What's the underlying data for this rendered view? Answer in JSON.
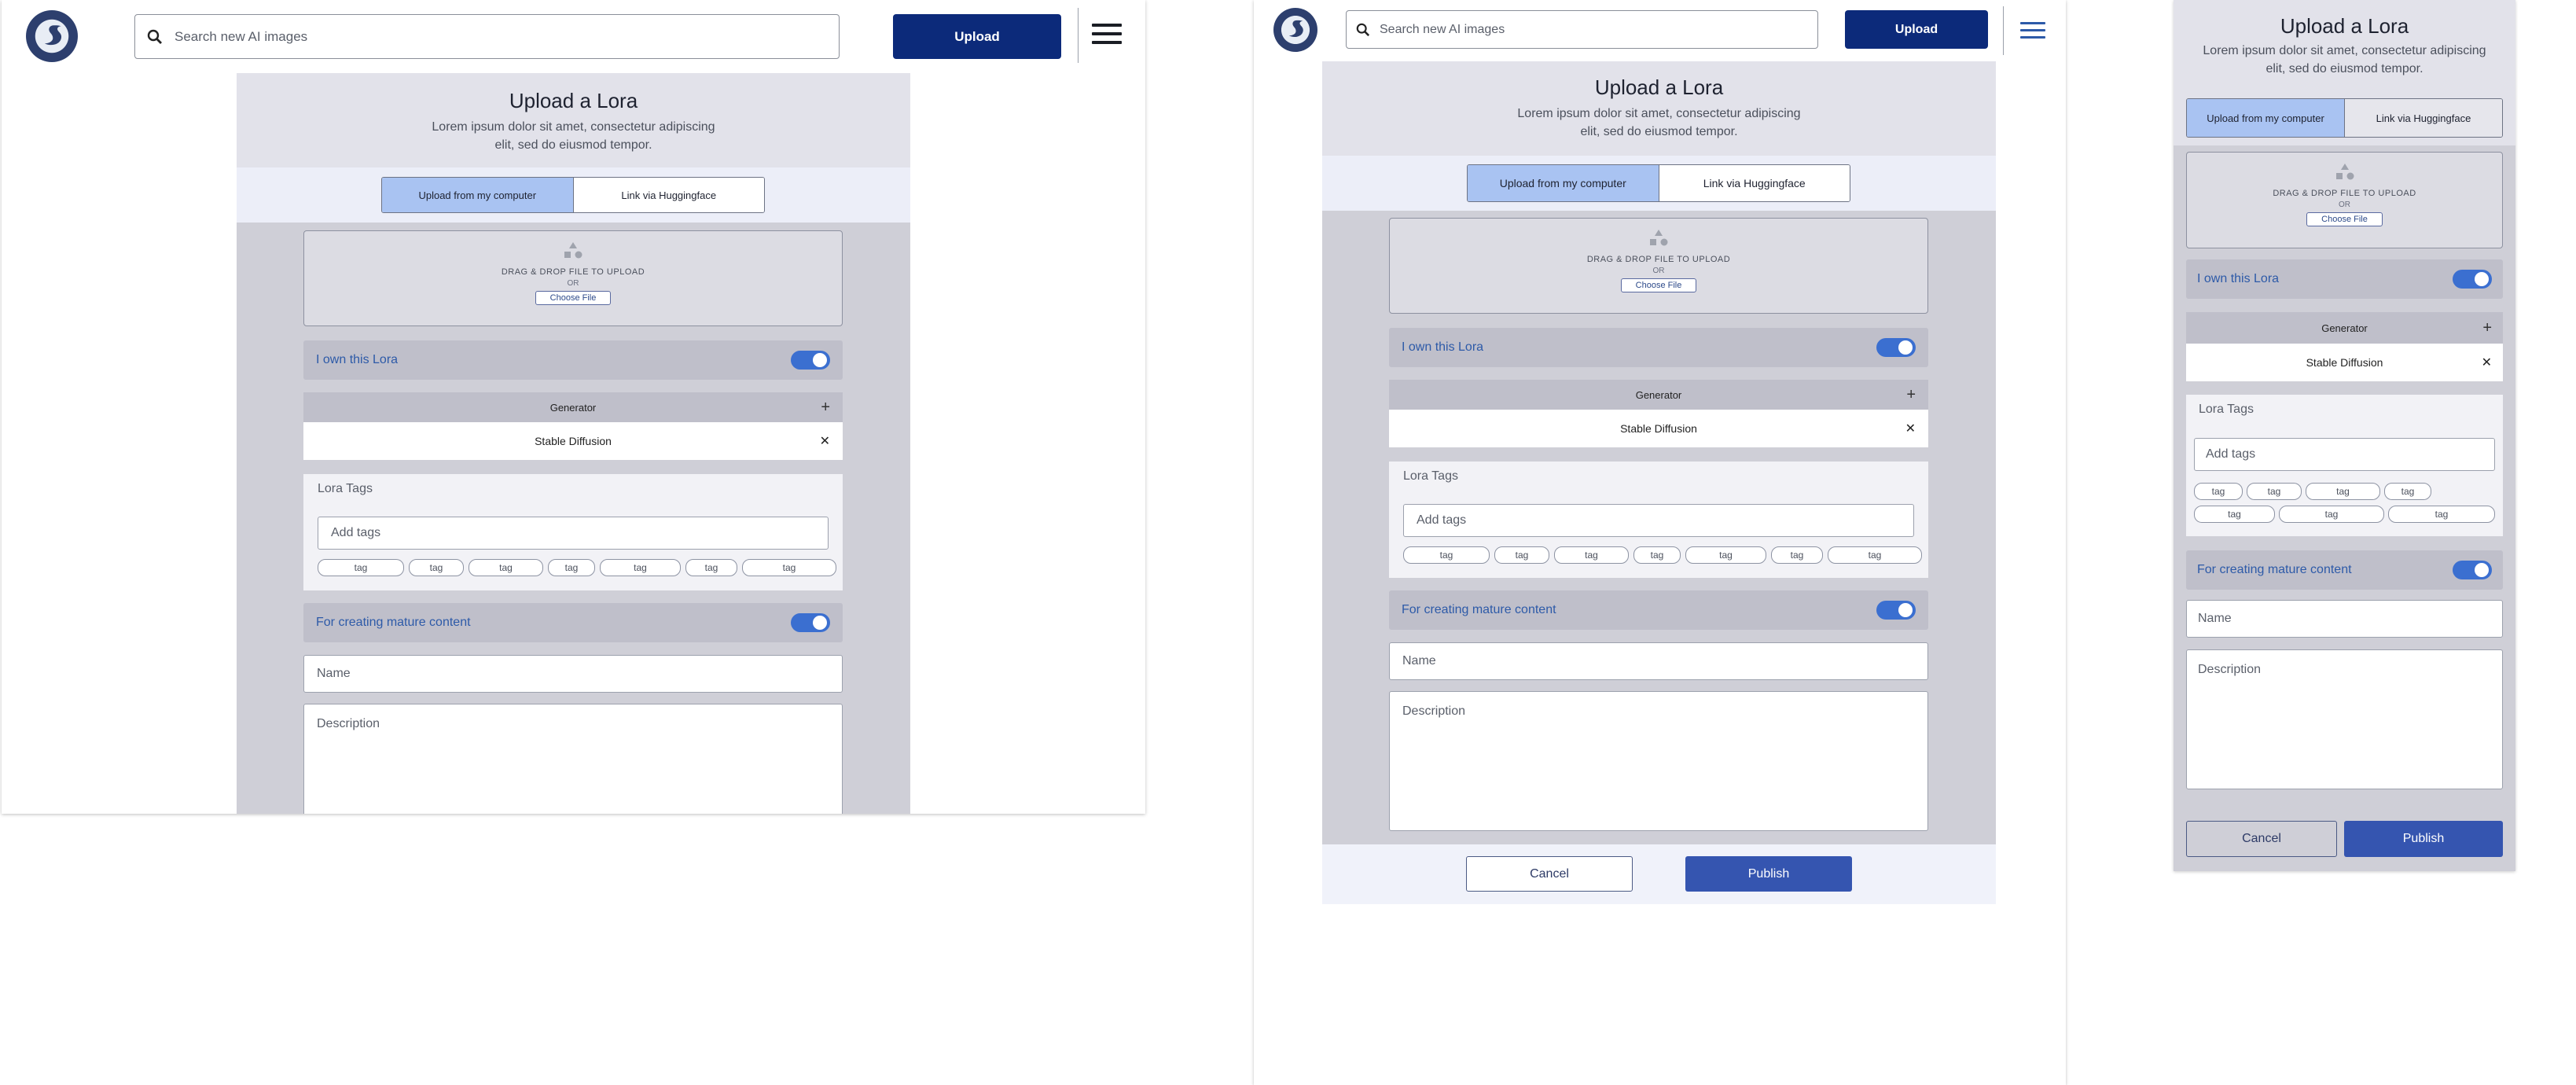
{
  "header": {
    "search_placeholder": "Search new AI images",
    "upload_label": "Upload"
  },
  "form": {
    "title": "Upload a Lora",
    "subtitle_line1": "Lorem ipsum dolor sit amet, consectetur adipiscing",
    "subtitle_line2": "elit, sed do eiusmod tempor.",
    "tabs": [
      "Upload from my computer",
      "Link via Huggingface"
    ],
    "drop_text": "DRAG & DROP FILE TO UPLOAD",
    "or_text": "OR",
    "choose_file": "Choose File",
    "own_label": "I own this Lora",
    "own_on": true,
    "generator_header": "Generator",
    "generator_value": "Stable Diffusion",
    "tags_title": "Lora Tags",
    "tags_placeholder": "Add tags",
    "tag_label": "tag",
    "mature_label": "For creating mature content",
    "mature_on": true,
    "name_placeholder": "Name",
    "description_placeholder": "Description",
    "cancel_label": "Cancel",
    "publish_label": "Publish"
  },
  "colors": {
    "primary": "#0c2a7a",
    "accent": "#3b6fd0",
    "panel": "#cfcfd7"
  },
  "icons": [
    "logo-swan",
    "search-icon",
    "menu-icon",
    "upload-shapes-icon",
    "plus-icon",
    "close-icon"
  ]
}
